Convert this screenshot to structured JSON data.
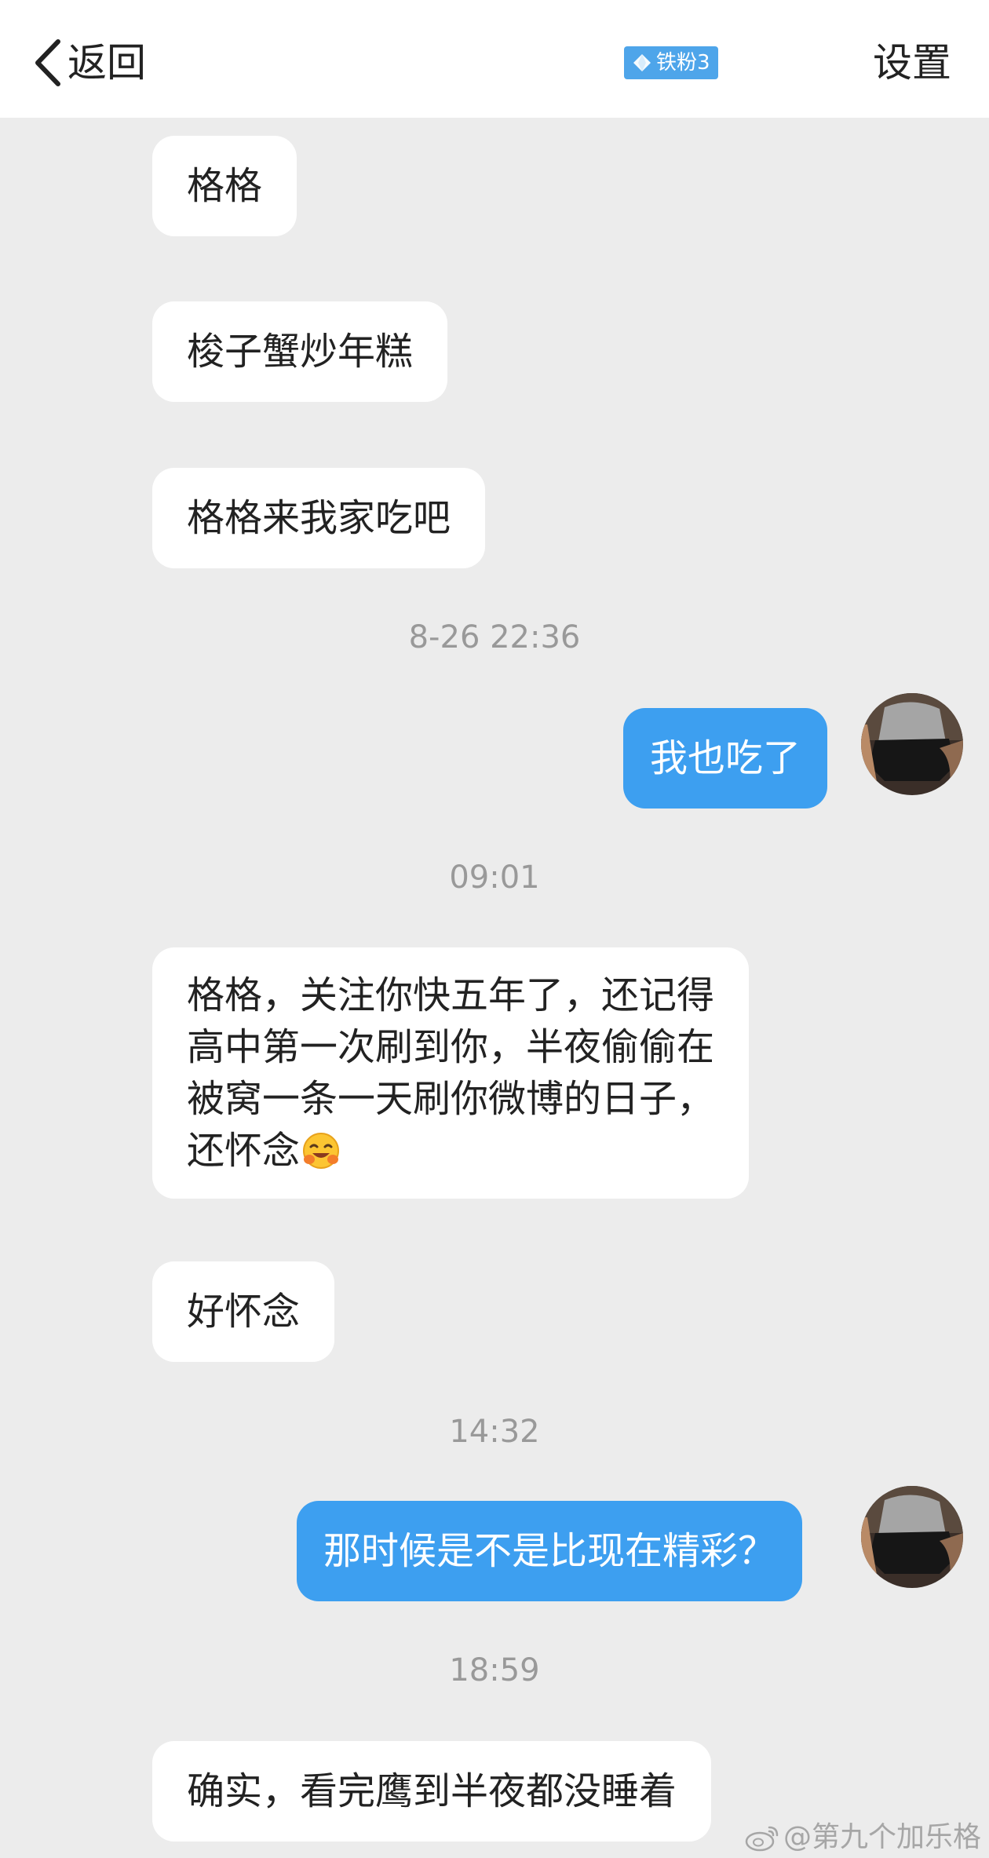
{
  "header": {
    "back_label": "返回",
    "badge_label": "铁粉3",
    "settings_label": "设置"
  },
  "messages": [
    {
      "direction": "incoming",
      "text": "格格"
    },
    {
      "direction": "incoming",
      "text": "梭子蟹炒年糕"
    },
    {
      "direction": "incoming",
      "text": "格格来我家吃吧"
    },
    {
      "type": "timestamp",
      "text": "8-26 22:36"
    },
    {
      "direction": "outgoing",
      "text": "我也吃了"
    },
    {
      "type": "timestamp",
      "text": "09:01"
    },
    {
      "direction": "incoming",
      "lines": [
        "格格，关注你快五年了，还记得",
        "高中第一次刷到你，半夜偷偷在",
        "被窝一条一天刷你微博的日子，",
        "还怀念"
      ],
      "emoji": "hugging-face-emoji"
    },
    {
      "direction": "incoming",
      "text": "好怀念"
    },
    {
      "type": "timestamp",
      "text": "14:32"
    },
    {
      "direction": "outgoing",
      "text": "那时候是不是比现在精彩？"
    },
    {
      "type": "timestamp",
      "text": "18:59"
    },
    {
      "direction": "incoming",
      "text": "确实，看完鹰到半夜都没睡着"
    }
  ],
  "watermark": "@第九个加乐格",
  "colors": {
    "background": "#ececec",
    "header": "#ffffff",
    "incoming_bubble": "#ffffff",
    "outgoing_bubble": "#3d9ff0",
    "timestamp": "#999999",
    "badge": "#4ea5ea"
  }
}
